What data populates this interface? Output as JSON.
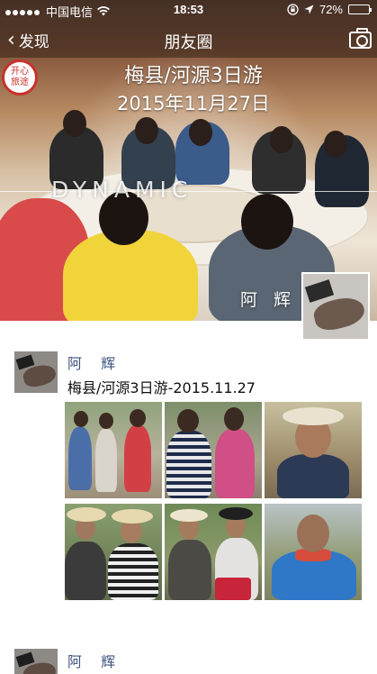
{
  "status_bar": {
    "carrier": "中国电信",
    "time": "18:53",
    "battery": "72%",
    "battery_level": 0.72
  },
  "nav": {
    "back_label": "发现",
    "title": "朋友圈"
  },
  "cover": {
    "title_line1": "梅县/河源3日游",
    "title_line2": "2015年11月27日",
    "overlay_text": "DYNAMIC",
    "stamp_line1": "开心",
    "stamp_line2": "旅途",
    "user_name": "阿 辉"
  },
  "posts": [
    {
      "name": "阿 辉",
      "text": "梅县/河源3日游-2015.11.27",
      "photos": [
        "photo-1",
        "photo-2",
        "photo-3",
        "photo-4",
        "photo-5",
        "photo-6"
      ]
    },
    {
      "name": "阿 辉"
    }
  ],
  "icons": {
    "back": "chevron-left-icon",
    "camera": "camera-icon",
    "wifi": "wifi-icon",
    "location": "location-arrow-icon",
    "lock": "rotation-lock-icon"
  }
}
